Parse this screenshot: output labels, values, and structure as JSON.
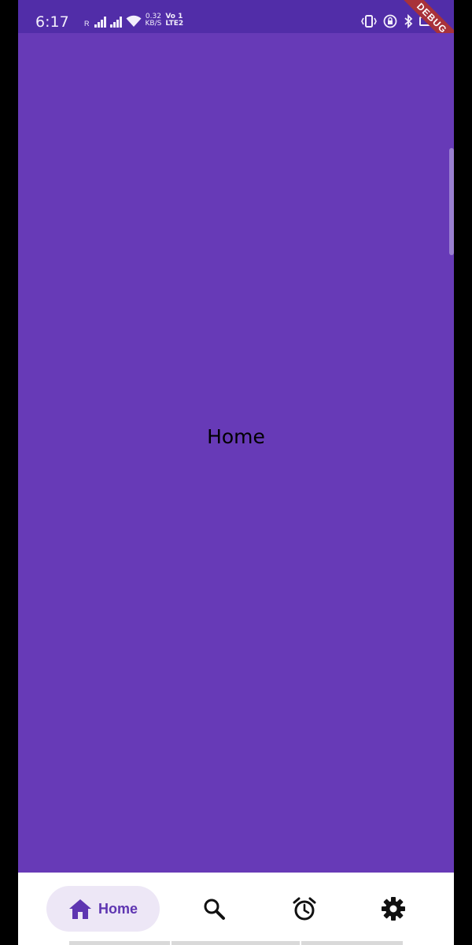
{
  "status_bar": {
    "time": "6:17",
    "net_speed_value": "0.32",
    "net_speed_unit": "KB/S",
    "volte_top": "Vo",
    "volte_bottom": "LTE",
    "sim1": "1",
    "sim2": "2",
    "roaming_letter": "R",
    "debug_label": "DEBUG"
  },
  "main": {
    "page_title": "Home"
  },
  "bottom_nav": {
    "items": [
      {
        "label": "Home",
        "icon": "home-icon",
        "selected": true
      },
      {
        "label": "",
        "icon": "search-icon",
        "selected": false
      },
      {
        "label": "",
        "icon": "alarm-icon",
        "selected": false
      },
      {
        "label": "",
        "icon": "settings-icon",
        "selected": false
      }
    ]
  },
  "colors": {
    "primary": "#673AB7",
    "status_bar": "#512DA8",
    "nav_active_bg": "#EDE7F6",
    "nav_active_fg": "#5E35B1",
    "debug_ribbon": "#A8323A"
  }
}
